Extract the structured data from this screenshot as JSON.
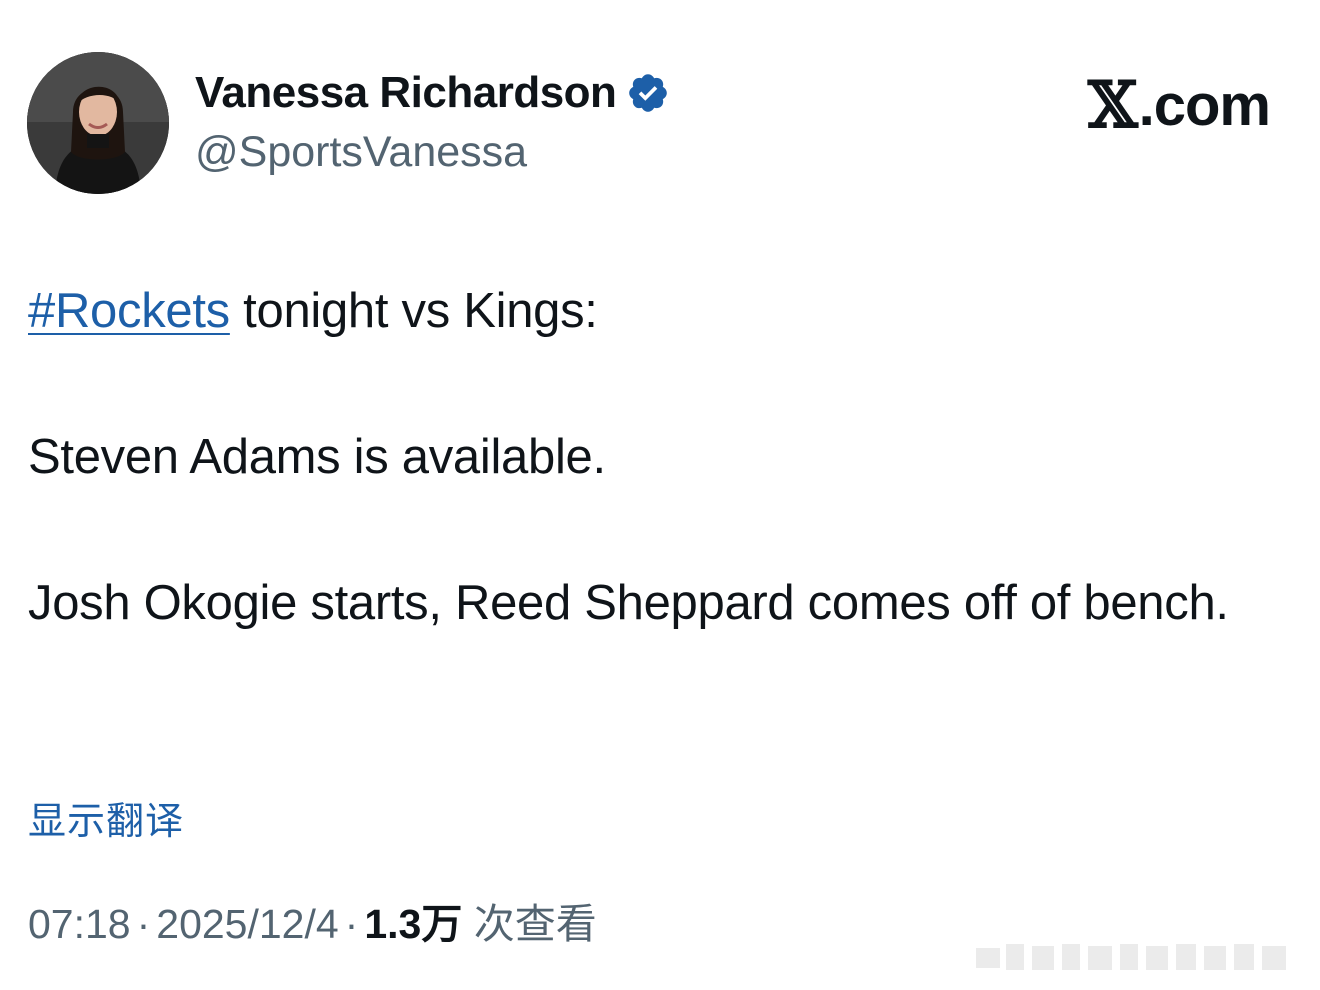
{
  "author": {
    "display_name": "Vanessa Richardson",
    "handle": "@SportsVanessa",
    "verified": true
  },
  "site": {
    "logo_text": ".com",
    "logo_glyph": "𝕏"
  },
  "tweet": {
    "hashtag": "#Rockets",
    "line1_rest": " tonight vs Kings:",
    "line2": "Steven Adams is available.",
    "line3": "Josh Okogie starts, Reed Sheppard comes off of bench."
  },
  "translate_label": "显示翻译",
  "meta": {
    "time": "07:18",
    "separator": "·",
    "date": "2025/12/4",
    "views_count": "1.3万",
    "views_label": " 次查看"
  },
  "colors": {
    "link": "#1d5fa8",
    "muted": "#536471",
    "text": "#0f1419",
    "verified_badge": "#1d5fa8"
  },
  "icons": {
    "verified": "verified-badge-icon",
    "avatar": "avatar-photo"
  }
}
